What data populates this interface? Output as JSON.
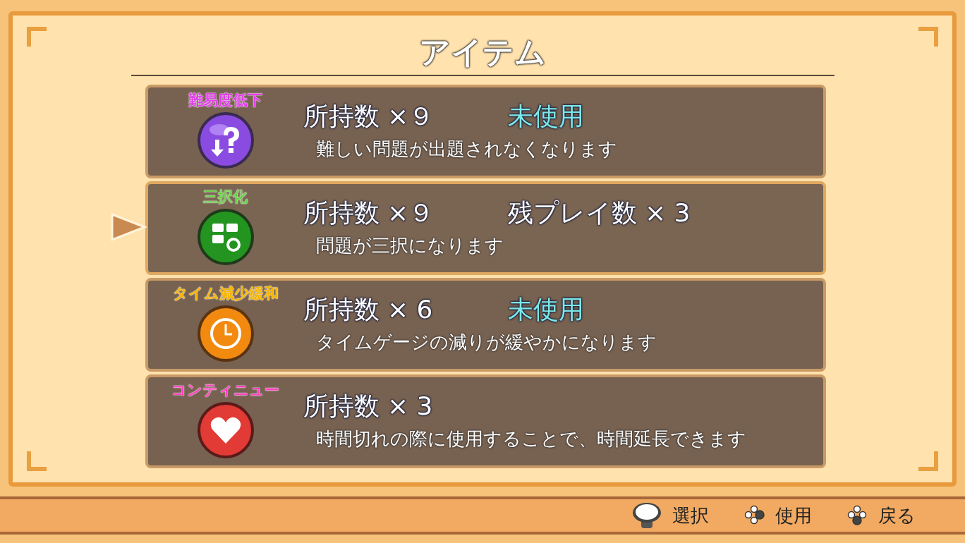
{
  "title": "アイテム",
  "items": [
    {
      "name": "難易度低下",
      "color": "#e040e8",
      "kind": "question",
      "count": "所持数 ×９",
      "status": {
        "kind": "unused",
        "text": "未使用"
      },
      "description": "難しい問題が出題されなくなります",
      "selected": false
    },
    {
      "name": "三択化",
      "color": "#6ccf4a",
      "kind": "three",
      "count": "所持数 ×９",
      "status": {
        "kind": "remaining",
        "text": "残プレイ数 × 3"
      },
      "description": "問題が三択になります",
      "selected": true
    },
    {
      "name": "タイム減少緩和",
      "color": "#f5b400",
      "kind": "clock",
      "count": "所持数 × 6",
      "status": {
        "kind": "unused",
        "text": "未使用"
      },
      "description": "タイムゲージの減りが緩やかになります",
      "selected": false
    },
    {
      "name": "コンティニュー",
      "color": "#ff40c0",
      "kind": "heart",
      "count": "所持数 × 3",
      "description": "時間切れの際に使用することで、時間延長できます",
      "selected": false
    }
  ],
  "footer": [
    {
      "kind": "stick",
      "label": "選択"
    },
    {
      "kind": "right",
      "label": "使用"
    },
    {
      "kind": "bottom",
      "label": "戻る"
    }
  ]
}
